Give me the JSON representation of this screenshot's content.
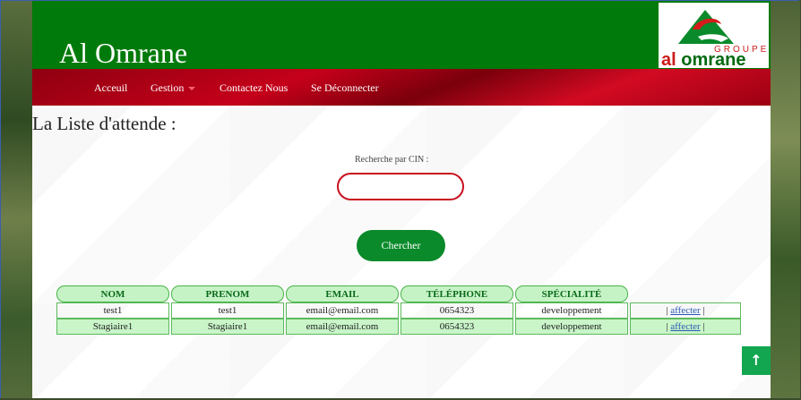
{
  "header": {
    "site_title": "Al Omrane",
    "logo": {
      "groupe": "GROUPE",
      "text_al": "al ",
      "text_omrane": "omrane"
    }
  },
  "nav": {
    "items": [
      {
        "label": "Acceuil"
      },
      {
        "label": "Gestion"
      },
      {
        "label": "Contactez Nous"
      },
      {
        "label": "Se Déconnecter"
      }
    ]
  },
  "main": {
    "title": "La Liste d'attende :",
    "search": {
      "label": "Recherche par CIN :",
      "value": "",
      "button": "Chercher"
    },
    "table": {
      "columns": [
        "NOM",
        "PRENOM",
        "EMAIL",
        "TÉLÉPHONE",
        "SPÉCIALITÉ"
      ],
      "rows": [
        {
          "nom": "test1",
          "prenom": "test1",
          "email": "email@email.com",
          "telephone": "0654323",
          "specialite": "developpement",
          "action": "affecter"
        },
        {
          "nom": "Stagiaire1",
          "prenom": "Stagiaire1",
          "email": "email@email.com",
          "telephone": "0654323",
          "specialite": "developpement",
          "action": "affecter"
        }
      ],
      "action_sep": "|"
    }
  },
  "scroll_top": {
    "icon": "arrow-up-icon",
    "glyph": "↑"
  },
  "colors": {
    "header_green": "#007a0a",
    "nav_red": "#c5001a",
    "button_green": "#0a8a2a",
    "input_border": "#c8101e"
  }
}
